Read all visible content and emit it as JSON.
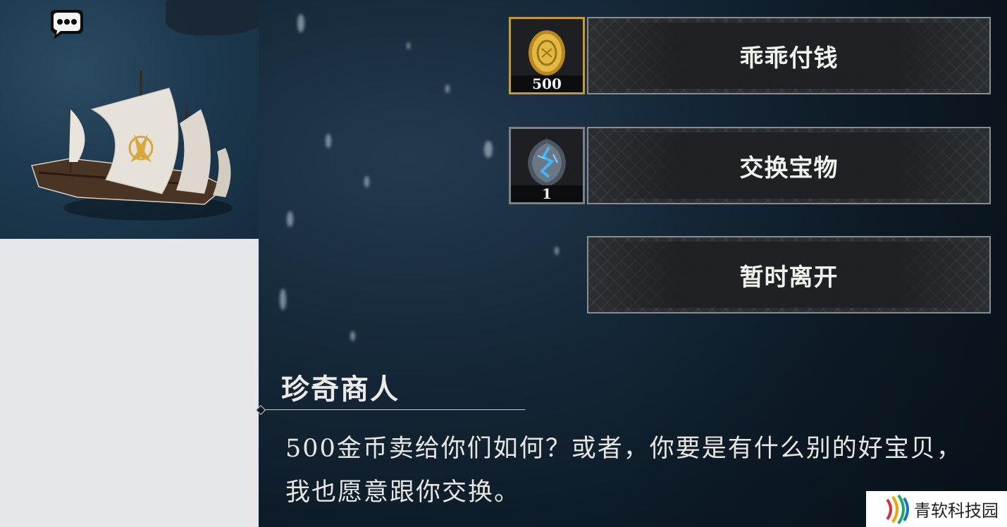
{
  "choices": [
    {
      "label": "乖乖付钱",
      "item": "gold-coin",
      "count": "500"
    },
    {
      "label": "交换宝物",
      "item": "blue-rune-stone",
      "count": "1"
    },
    {
      "label": "暂时离开"
    }
  ],
  "dialogue": {
    "speaker": "珍奇商人",
    "text": "500金币卖给你们如何？或者，你要是有什么别的好宝贝，我也愿意跟你交换。"
  },
  "map": {
    "icons": [
      "speech-bubble-icon",
      "ship-icon"
    ]
  },
  "watermark": {
    "text": "青软科技园",
    "logo": "waveform-logo"
  },
  "colors": {
    "gold_border": "#c79a2a",
    "button_border": "#8a8d90",
    "text": "#e8e6e1"
  }
}
